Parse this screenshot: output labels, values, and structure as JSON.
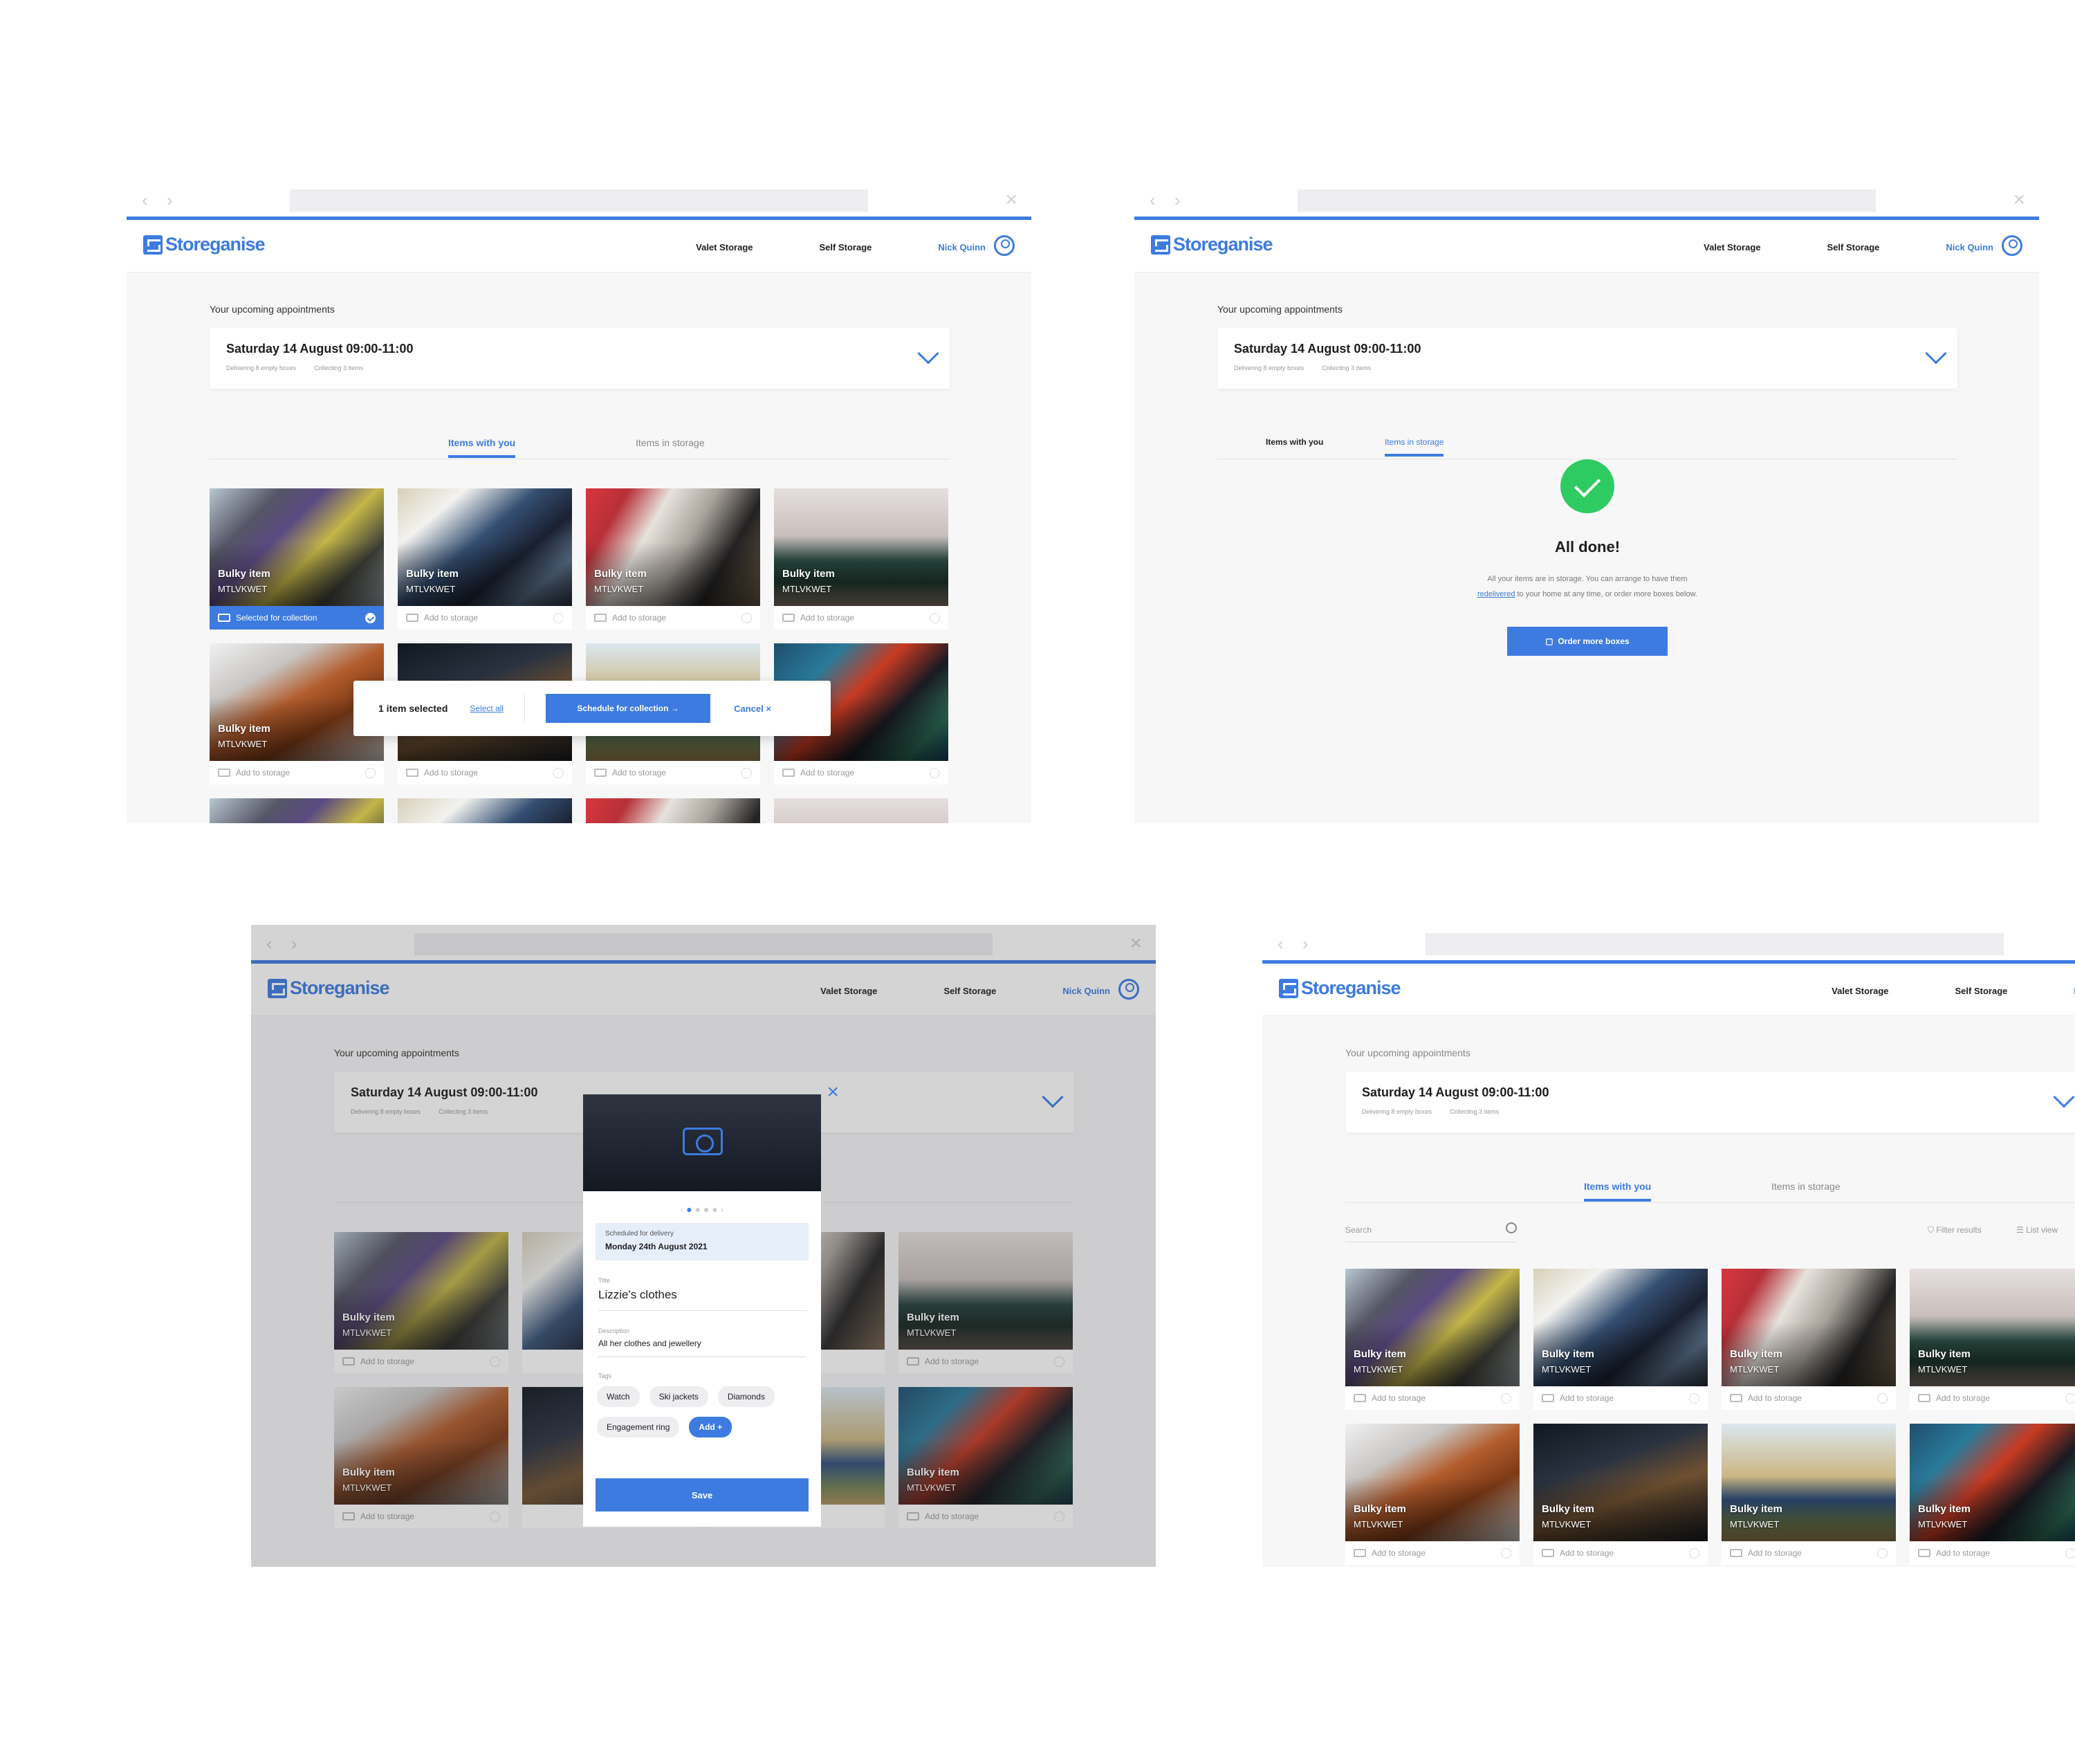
{
  "common": {
    "brand": "Storeganise",
    "nav_valet": "Valet Storage",
    "nav_self": "Self Storage",
    "user": "Nick Quinn",
    "upcoming_label": "Your upcoming appointments",
    "appt_title": "Saturday 14 August 09:00-11:00",
    "appt_delivering": "Delivering 8 empty boxes",
    "appt_collecting": "Collecting 3 items",
    "tab_with_you": "Items with you",
    "tab_in_storage": "Items in storage",
    "item_title": "Bulky item",
    "item_code": "MTLVKWET",
    "add_to_storage": "Add to storage",
    "selected_for_collection": "Selected for collection"
  },
  "selection_bar": {
    "count": "1 item selected",
    "select_all": "Select all",
    "schedule": "Schedule for collection",
    "cancel": "Cancel"
  },
  "done": {
    "title": "All done!",
    "line1": "All your items are in storage. You can arrange to have them",
    "link": "redelivered",
    "line2": " to your home at any time, or order more boxes below.",
    "button": "Order more boxes"
  },
  "modal": {
    "scheduled_label": "Scheduled for delivery",
    "scheduled_date": "Monday 24th August 2021",
    "title_label": "Title",
    "title_value": "Lizzie's clothes",
    "desc_label": "Description",
    "desc_value": "All her clothes and jewellery",
    "tags_label": "Tags",
    "tags": [
      "Watch",
      "Ski jackets",
      "Diamonds",
      "Engagement ring"
    ],
    "add_tag": "Add",
    "save": "Save"
  },
  "toolbar": {
    "search_placeholder": "Search",
    "filter": "Filter results",
    "list_view": "List view"
  },
  "colors": {
    "accent": "#3d7be0",
    "success": "#2ecb63"
  }
}
